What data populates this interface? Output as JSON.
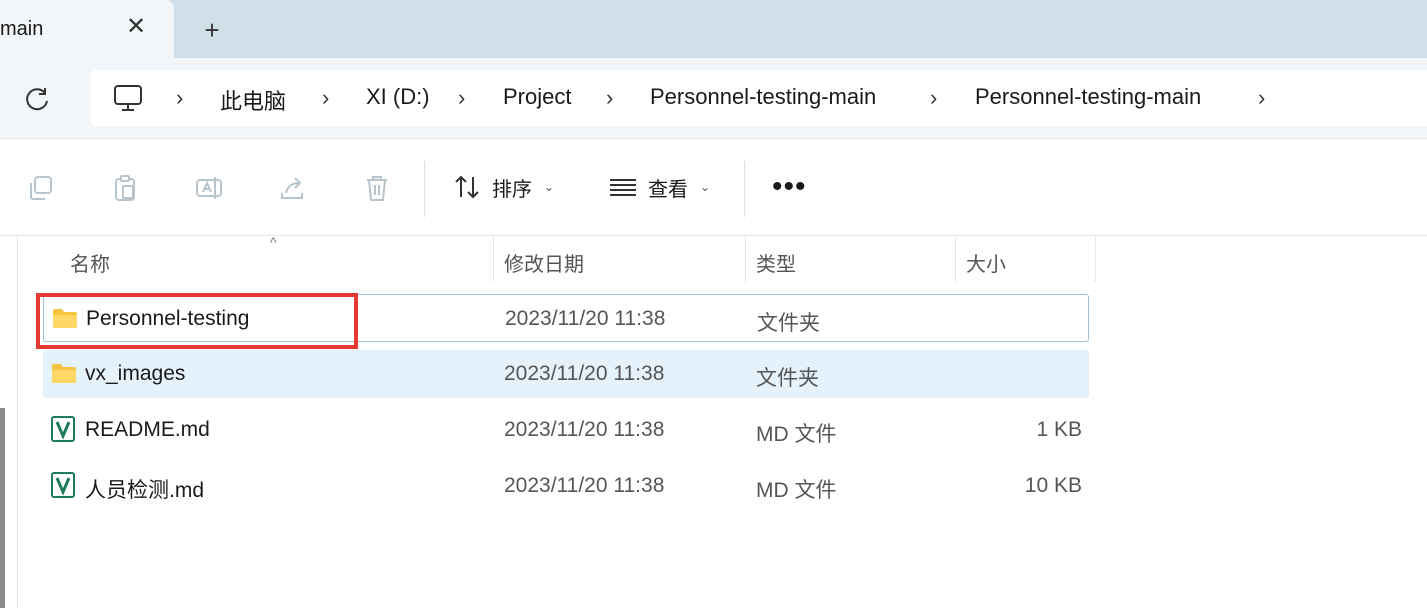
{
  "tab": {
    "title": "main",
    "close": "✕",
    "new_tab": "+"
  },
  "breadcrumb": [
    {
      "label": "此电脑"
    },
    {
      "label": "XI (D:)"
    },
    {
      "label": "Project"
    },
    {
      "label": "Personnel-testing-main"
    },
    {
      "label": "Personnel-testing-main"
    }
  ],
  "toolbar": {
    "sort_label": "排序",
    "view_label": "查看",
    "more_label": "•••",
    "caret": "⌄"
  },
  "columns": {
    "name": "名称",
    "modified": "修改日期",
    "type": "类型",
    "size": "大小",
    "sort_indicator": "^"
  },
  "files": [
    {
      "name": "Personnel-testing",
      "modified": "2023/11/20 11:38",
      "type": "文件夹",
      "size": "",
      "icon": "folder-icon"
    },
    {
      "name": "vx_images",
      "modified": "2023/11/20 11:38",
      "type": "文件夹",
      "size": "",
      "icon": "folder-icon"
    },
    {
      "name": "README.md",
      "modified": "2023/11/20 11:38",
      "type": "MD 文件",
      "size": "1 KB",
      "icon": "markdown-file-icon"
    },
    {
      "name": "人员检测.md",
      "modified": "2023/11/20 11:38",
      "type": "MD 文件",
      "size": "10 KB",
      "icon": "markdown-file-icon"
    }
  ],
  "colors": {
    "highlight": "#e53935",
    "selection": "#e5f1fb",
    "tabstrip": "#cfe0e8"
  }
}
